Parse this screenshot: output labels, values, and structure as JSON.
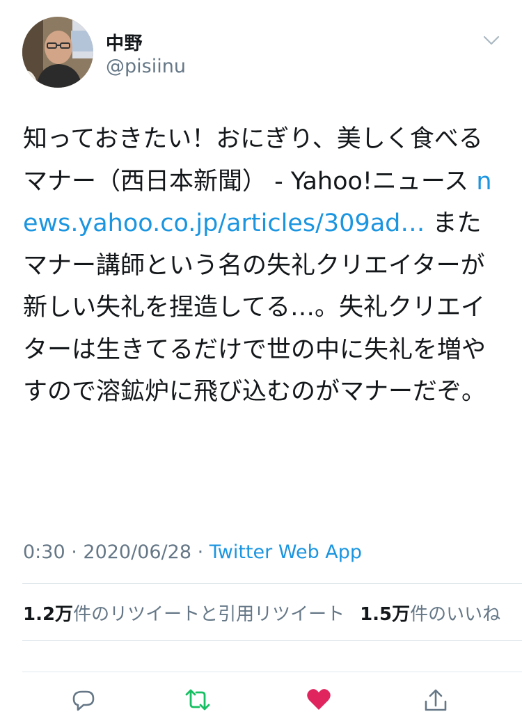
{
  "user": {
    "display_name": "中野",
    "handle": "@pisiinu"
  },
  "tweet": {
    "text_part1": "知っておきたい！おにぎり、美しく食べるマナー（西日本新聞） - Yahoo!ニュース ",
    "link_text": "news.yahoo.co.jp/articles/309ad…",
    "text_part2": " またマナー講師という名の失礼クリエイターが新しい失礼を捏造してる…。失礼クリエイターは生きてるだけで世の中に失礼を増やすので溶鉱炉に飛び込むのがマナーだぞ。",
    "time": "0:30",
    "separator1": " · ",
    "date": "2020/06/28",
    "separator2": " · ",
    "source": "Twitter Web App"
  },
  "stats": {
    "retweets_count": "1.2万",
    "retweets_label": "件のリツイートと引用リツイート",
    "likes_count": "1.5万",
    "likes_label": "件のいいね"
  },
  "icons": {
    "menu": "chevron-down-icon",
    "reply": "reply-icon",
    "retweet": "retweet-icon",
    "like": "heart-icon",
    "share": "share-icon"
  },
  "colors": {
    "link": "#1b95e0",
    "muted": "#657786",
    "retweet": "#17bf63",
    "like": "#e0245e"
  }
}
